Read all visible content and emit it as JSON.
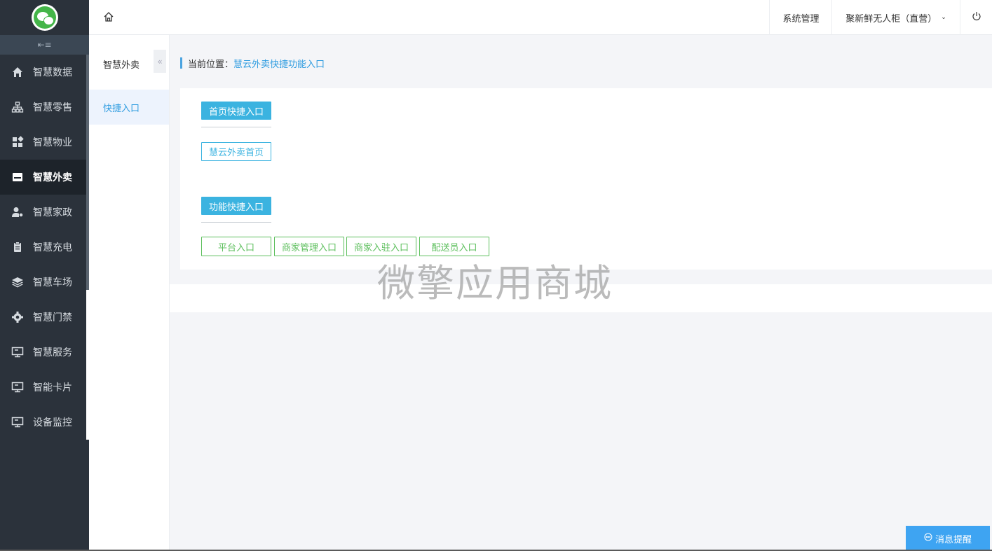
{
  "sidebar": {
    "items": [
      {
        "label": "智慧数据",
        "icon": "home-icon"
      },
      {
        "label": "智慧零售",
        "icon": "sitemap-icon"
      },
      {
        "label": "智慧物业",
        "icon": "grid-icon"
      },
      {
        "label": "智慧外卖",
        "icon": "store-icon"
      },
      {
        "label": "智慧家政",
        "icon": "user-gear-icon"
      },
      {
        "label": "智慧充电",
        "icon": "clipboard-icon"
      },
      {
        "label": "智慧车场",
        "icon": "layers-icon"
      },
      {
        "label": "智慧门禁",
        "icon": "gear-icon"
      },
      {
        "label": "智慧服务",
        "icon": "monitor-icon"
      },
      {
        "label": "智能卡片",
        "icon": "monitor-icon"
      },
      {
        "label": "设备监控",
        "icon": "monitor-icon"
      }
    ]
  },
  "header": {
    "system": "系统管理",
    "store": "聚新鲜无人柜（直营）"
  },
  "subnav": {
    "title": "智慧外卖",
    "collapse": "«",
    "link": "快捷入口"
  },
  "breadcrumb": {
    "prefix": "当前位置：",
    "current": "慧云外卖快捷功能入口"
  },
  "sections": {
    "home_title": "首页快捷入口",
    "home_btn": "慧云外卖首页",
    "func_title": "功能快捷入口",
    "func_btns": [
      "平台入口",
      "商家管理入口",
      "商家入驻入口",
      "配送员入口"
    ]
  },
  "watermark": "微擎应用商城",
  "message": "消息提醒",
  "colors": {
    "sidebar": "#2b323b",
    "accent": "#3bb3e0",
    "green": "#5cbf5c",
    "link": "#2e9ce0"
  }
}
